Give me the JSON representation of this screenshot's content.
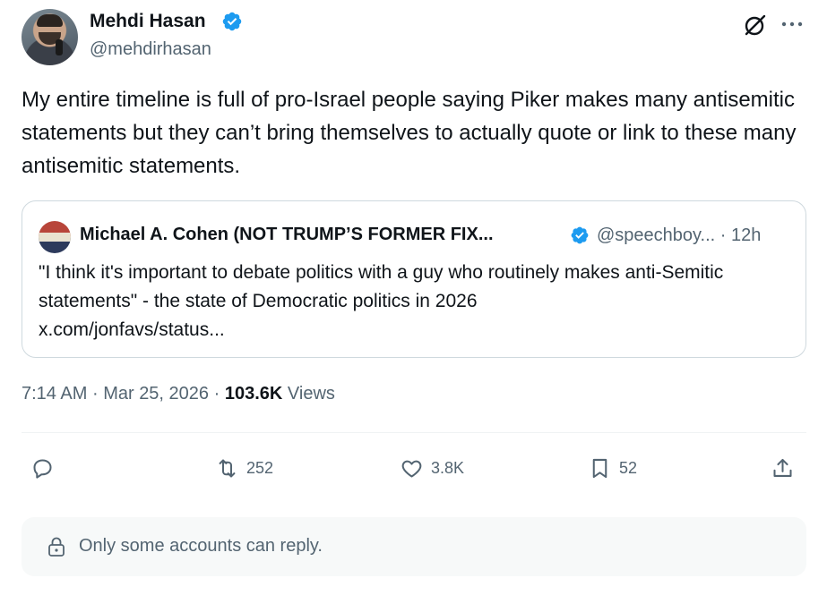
{
  "author": {
    "name": "Mehdi Hasan",
    "handle": "@mehdirhasan",
    "verified": true
  },
  "tweet_text": "My entire timeline is full of pro-Israel people saying Piker makes many antisemitic statements but they can’t bring themselves to actually quote or link to these many antisemitic statements.",
  "quote": {
    "name": "Michael A. Cohen (NOT TRUMP’S FORMER FIX...",
    "handle_time": "@speechboy... · 12h",
    "text": "\"I think it's important to debate politics with a guy who routinely makes anti-Semitic statements\" - the state of Democratic politics in 2026",
    "link": "x.com/jonfavs/status..."
  },
  "meta": {
    "time": "7:14 AM",
    "separator": "·",
    "date": "Mar 25, 2026",
    "views_count": "103.6K",
    "views_label": "Views"
  },
  "actions": {
    "reposts": "252",
    "likes": "3.8K",
    "bookmarks": "52"
  },
  "reply_restriction": "Only some accounts can reply.",
  "colors": {
    "text": "#0f1419",
    "secondary": "#536471",
    "verified": "#1d9bf0",
    "border": "#cfd9de"
  },
  "icons": [
    "verified-badge-icon",
    "grok-icon",
    "more-icon",
    "reply-icon",
    "repost-icon",
    "like-icon",
    "bookmark-icon",
    "share-icon",
    "lock-icon"
  ]
}
